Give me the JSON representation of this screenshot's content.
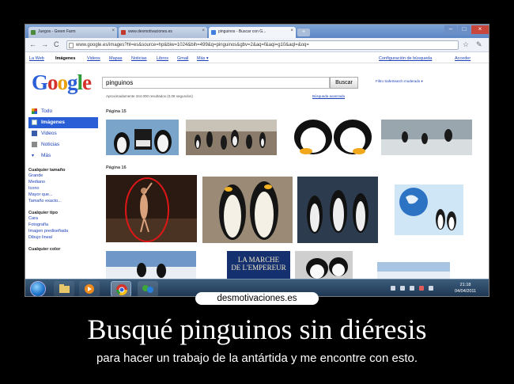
{
  "browser": {
    "tabs": [
      {
        "label": "Juegos - Green Farm",
        "favicon_color": "#4a8a3a"
      },
      {
        "label": "www.desmotivaciones.es",
        "favicon_color": "#c0392b"
      },
      {
        "label": "pinguinos - Buscar con G...",
        "favicon_color": "#3f7fe0"
      }
    ],
    "address": "www.google.es/images?hl=es&source=hp&biw=1024&bih=499&q=pinguinos&gbv=2&aq=f&aqi=g10&aql=&oq="
  },
  "google_bar": {
    "links": [
      "La Web",
      "Imágenes",
      "Videos",
      "Mapas",
      "Noticias",
      "Libros",
      "Gmail",
      "Más ▾"
    ],
    "settings": "Configuración de búsqueda",
    "login": "Acceder"
  },
  "search": {
    "query": "pinguinos",
    "button": "Buscar",
    "safesearch": "Filtro SafeSearch moderado ▾",
    "stats": "Aproximadamente 344.000 resultados (0,08 segundos)",
    "advanced": "Búsqueda avanzada"
  },
  "sidebar": {
    "items": [
      {
        "label": "Todo",
        "icon": "four-color-icon",
        "selected": false
      },
      {
        "label": "Imágenes",
        "icon": "images-icon",
        "selected": true
      },
      {
        "label": "Videos",
        "icon": "video-icon",
        "selected": false
      },
      {
        "label": "Noticias",
        "icon": "news-icon",
        "selected": false
      },
      {
        "label": "Más",
        "icon": "chevron-down-icon",
        "selected": false
      }
    ],
    "size_header": "Cualquier tamaño",
    "size_links": [
      "Grande",
      "Mediano",
      "Icono",
      "Mayor que...",
      "Tamaño exacto..."
    ],
    "type_header": "Cualquier tipo",
    "type_links": [
      "Cara",
      "Fotografía",
      "Imagen prediseñada",
      "Dibujo lineal"
    ],
    "color_header": "Cualquier color"
  },
  "results": {
    "page15": "Página 15",
    "page16": "Página 16",
    "movie_title_1": "LA MARCHE",
    "movie_title_2": "DE L'EMPEREUR"
  },
  "taskbar": {
    "time": "21:18",
    "date": "04/04/2011"
  },
  "poster": {
    "brand": "desmotivaciones.es",
    "headline": "Busqué pinguinos sin diéresis",
    "subline": "para hacer un trabajo de la antártida y me encontre con esto."
  }
}
